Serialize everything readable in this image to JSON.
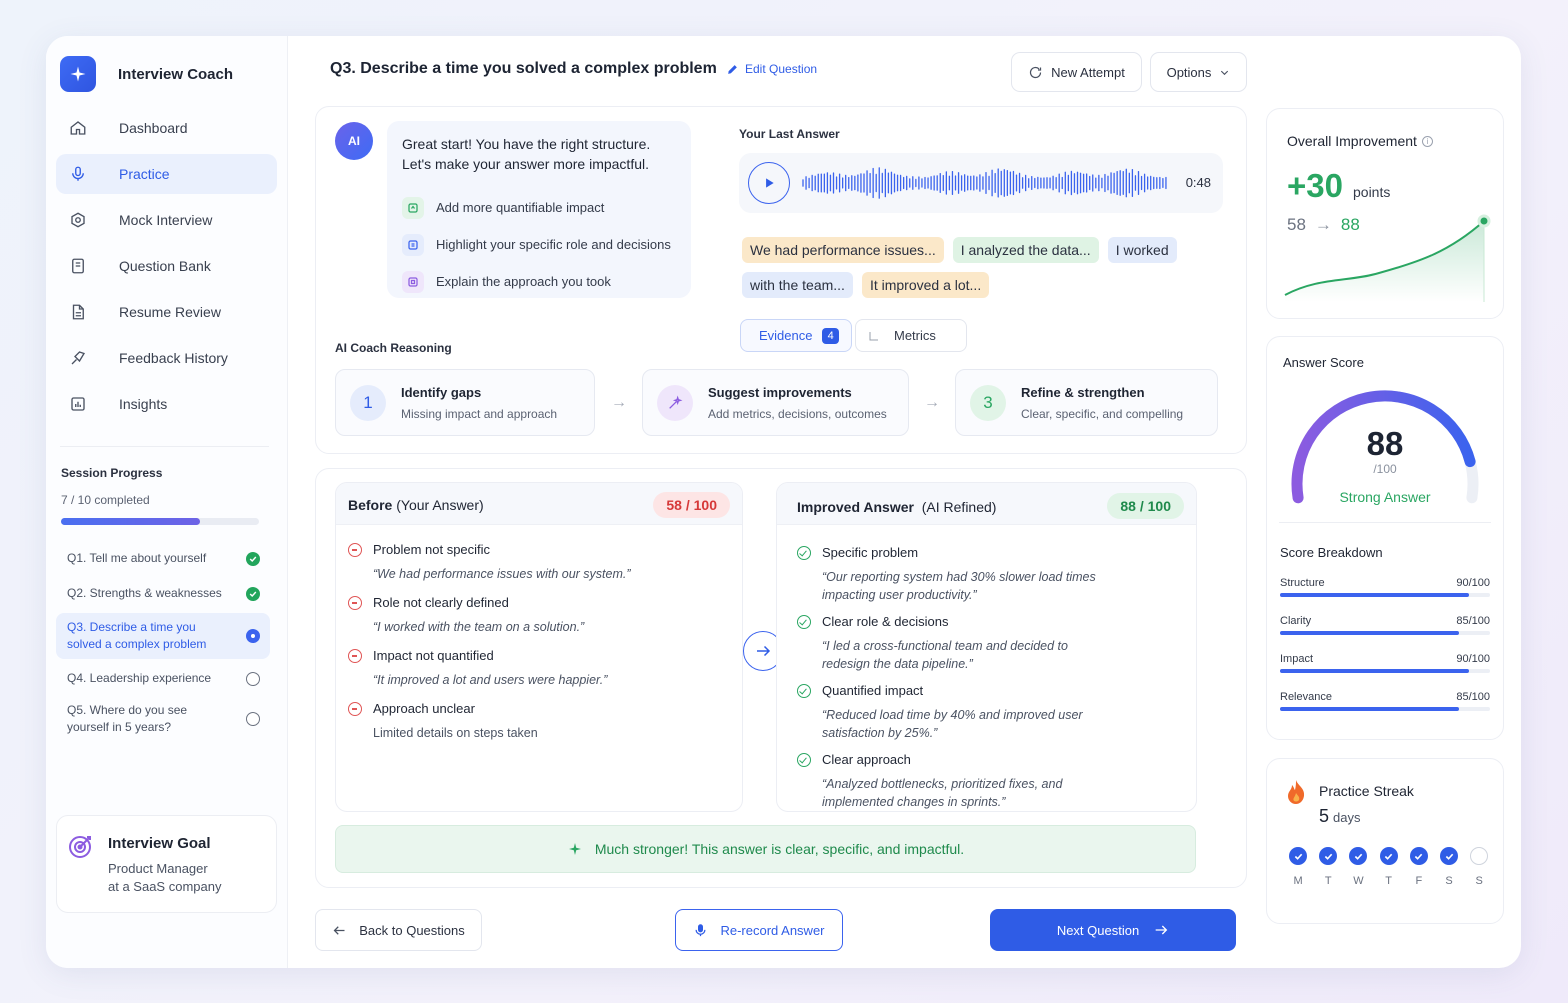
{
  "app": {
    "title": "Interview Coach"
  },
  "nav": [
    {
      "label": "Dashboard",
      "icon": "home-icon"
    },
    {
      "label": "Practice",
      "icon": "microphone-icon",
      "active": true
    },
    {
      "label": "Mock Interview",
      "icon": "target-icon"
    },
    {
      "label": "Question Bank",
      "icon": "book-icon"
    },
    {
      "label": "Resume Review",
      "icon": "document-icon"
    },
    {
      "label": "Feedback History",
      "icon": "history-icon"
    },
    {
      "label": "Insights",
      "icon": "chart-icon"
    }
  ],
  "session": {
    "title": "Session Progress",
    "count": "7 / 10 completed",
    "progress": 0.7,
    "questions": [
      {
        "label": "Q1. Tell me about yourself",
        "status": "done"
      },
      {
        "label": "Q2. Strengths & weaknesses",
        "status": "done"
      },
      {
        "label": "Q3. Describe a time you solved a complex problem",
        "status": "current"
      },
      {
        "label": "Q4. Leadership experience",
        "status": "todo"
      },
      {
        "label": "Q5. Where do you see yourself in 5 years?",
        "status": "todo"
      }
    ]
  },
  "goal": {
    "title": "Interview Goal",
    "line1": "Product Manager",
    "line2": "at a SaaS company"
  },
  "header": {
    "question": "Q3. Describe a time you solved a complex problem",
    "edit_label": "Edit Question",
    "new_attempt": "New Attempt",
    "options": "Options"
  },
  "coach": {
    "avatar_text": "AI",
    "message_line1": "Great start! You have the right structure.",
    "message_line2": "Let's make your answer more impactful.",
    "tips": [
      {
        "label": "Add more quantifiable impact",
        "color": "#2aa662",
        "bg": "#e3f4e8"
      },
      {
        "label": "Highlight your specific role and decisions",
        "color": "#3b63ee",
        "bg": "#e5ecfc"
      },
      {
        "label": "Explain the approach you took",
        "color": "#8c5ce0",
        "bg": "#efe6fb"
      }
    ]
  },
  "last_answer": {
    "label": "Your Last Answer",
    "duration": "0:48",
    "chips": [
      {
        "text": "We had performance issues...",
        "tone": "y"
      },
      {
        "text": "I analyzed the data...",
        "tone": "g"
      },
      {
        "text": "I worked",
        "tone": "b"
      },
      {
        "text": "with the team...",
        "tone": "b"
      },
      {
        "text": "It improved a lot...",
        "tone": "y"
      }
    ],
    "tabs": {
      "evidence": "Evidence",
      "evidence_count": "4",
      "metrics": "Metrics"
    }
  },
  "reasoning": {
    "title": "AI Coach Reasoning",
    "steps": [
      {
        "num": "1",
        "title": "Identify gaps",
        "sub": "Missing impact and approach"
      },
      {
        "num": "",
        "title": "Suggest improvements",
        "sub": "Add metrics, decisions, outcomes"
      },
      {
        "num": "3",
        "title": "Refine & strengthen",
        "sub": "Clear, specific, and compelling"
      }
    ]
  },
  "before": {
    "title_bold": "Before",
    "title_rest": "(Your Answer)",
    "score": "58 / 100",
    "items": [
      {
        "label": "Problem not specific",
        "quote": "“We had performance issues with our system.”"
      },
      {
        "label": "Role not clearly defined",
        "quote": "“I worked with the team on a solution.”"
      },
      {
        "label": "Impact not quantified",
        "quote": "“It improved a lot and users were happier.”"
      },
      {
        "label": "Approach unclear",
        "quote": "Limited details on steps taken"
      }
    ]
  },
  "improved": {
    "title_bold": "Improved Answer",
    "title_rest": "(AI Refined)",
    "score": "88 / 100",
    "items": [
      {
        "label": "Specific problem",
        "quote": "“Our reporting system had 30% slower load times impacting user productivity.”"
      },
      {
        "label": "Clear role & decisions",
        "quote": "“I led a cross-functional team and decided to redesign the data pipeline.”"
      },
      {
        "label": "Quantified impact",
        "quote": "“Reduced load time by 40% and improved user satisfaction by 25%.”"
      },
      {
        "label": "Clear approach",
        "quote": "“Analyzed bottlenecks, prioritized fixes, and implemented changes in sprints.”"
      }
    ]
  },
  "success_message": "Much stronger! This answer is clear, specific, and impactful.",
  "footer": {
    "back": "Back to Questions",
    "rerecord": "Re-record Answer",
    "next": "Next Question"
  },
  "improvement": {
    "title": "Overall Improvement",
    "delta": "+30",
    "unit": "points",
    "from": "58",
    "to": "88"
  },
  "answer_score": {
    "title": "Answer Score",
    "value": "88",
    "max": "/100",
    "fraction": 0.88,
    "verdict": "Strong Answer",
    "breakdown_title": "Score Breakdown",
    "breakdown": [
      {
        "label": "Structure",
        "value": "90/100",
        "fraction": 0.9
      },
      {
        "label": "Clarity",
        "value": "85/100",
        "fraction": 0.85
      },
      {
        "label": "Impact",
        "value": "90/100",
        "fraction": 0.9
      },
      {
        "label": "Relevance",
        "value": "85/100",
        "fraction": 0.85
      }
    ]
  },
  "streak": {
    "title": "Practice Streak",
    "count": "5",
    "unit": "days",
    "days": [
      {
        "label": "M",
        "done": true
      },
      {
        "label": "T",
        "done": true
      },
      {
        "label": "W",
        "done": true
      },
      {
        "label": "T",
        "done": true
      },
      {
        "label": "F",
        "done": true
      },
      {
        "label": "S",
        "done": true
      },
      {
        "label": "S",
        "done": false
      }
    ]
  },
  "colors": {
    "accent": "#2f5ce6",
    "success": "#2aa662",
    "danger": "#d63838"
  }
}
